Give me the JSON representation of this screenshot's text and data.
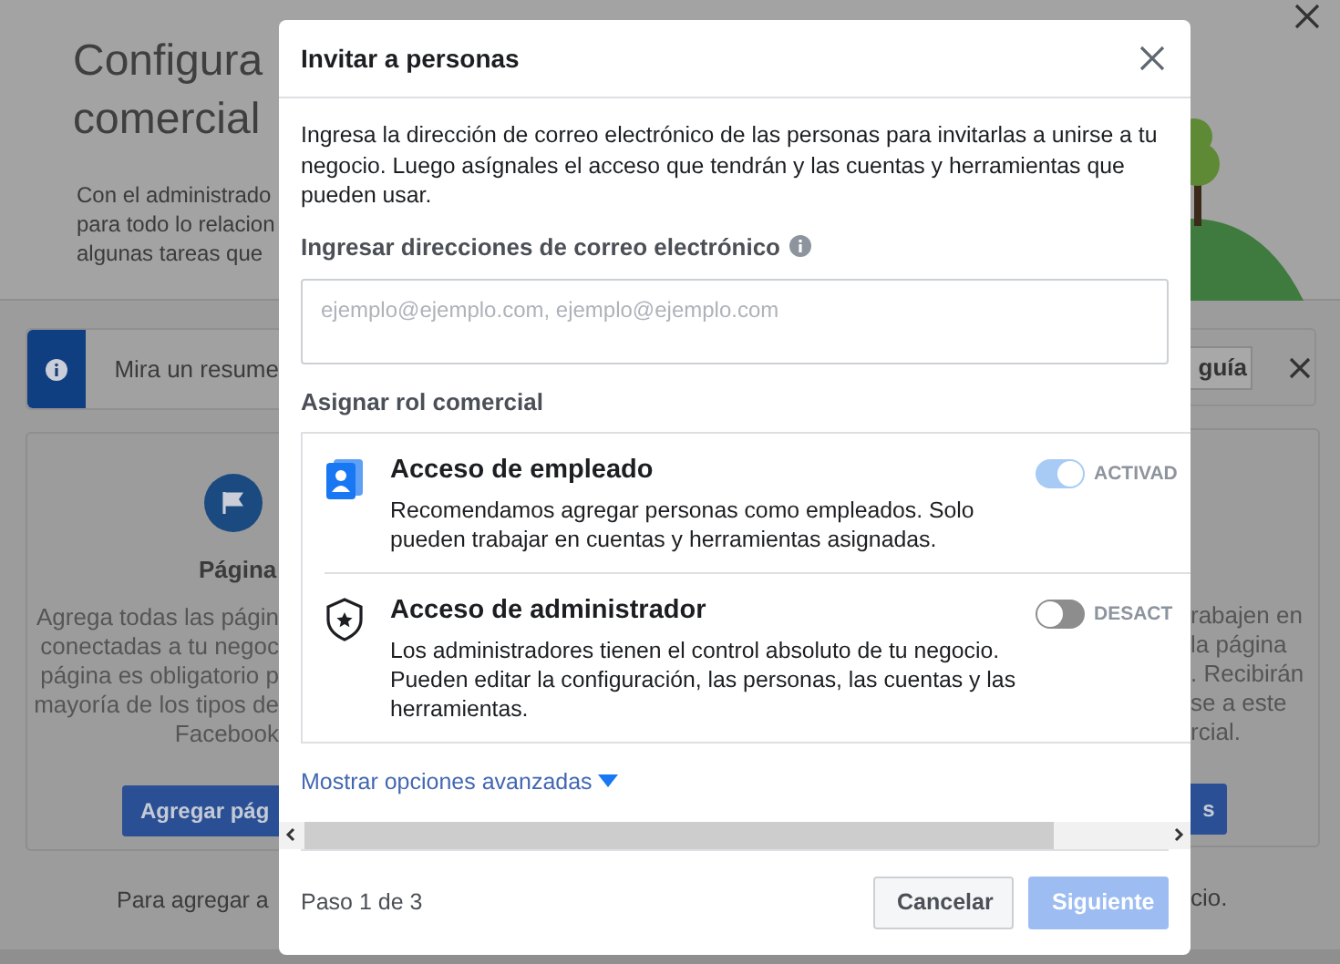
{
  "background": {
    "title_lines": [
      "Configura",
      "comercial"
    ],
    "intro_lines": [
      "Con el administrado",
      "para todo lo relacion",
      "algunas tareas que"
    ],
    "banner": {
      "text": "Mira un resume",
      "button": "guía"
    },
    "left_card": {
      "title": "Página",
      "lines": [
        "Agrega todas las págin",
        "conectadas a tu negoc",
        "página es obligatorio p",
        "mayoría de los tipos de",
        "Facebook"
      ],
      "button": "Agregar pág"
    },
    "right_card": {
      "lines": [
        "rabajen en",
        "la página",
        ". Recibirán",
        "se a este",
        "rcial."
      ],
      "button": "s"
    },
    "footer_left": "Para agregar a",
    "footer_right": "cio."
  },
  "modal": {
    "title": "Invitar a personas",
    "description": "Ingresa la dirección de correo electrónico de las personas para invitarlas a unirse a tu negocio. Luego asígnales el acceso que tendrán y las cuentas y herramientas que pueden usar.",
    "email_label": "Ingresar direcciones de correo electrónico",
    "email_placeholder": "ejemplo@ejemplo.com, ejemplo@ejemplo.com",
    "role_heading": "Asignar rol comercial",
    "roles": [
      {
        "kind": "employee",
        "name": "Acceso de empleado",
        "description": "Recomendamos agregar personas como empleados. Solo pueden trabajar en cuentas y herramientas asignadas.",
        "toggle_label": "ACTIVAD",
        "on": true
      },
      {
        "kind": "admin",
        "name": "Acceso de administrador",
        "description": "Los administradores tienen el control absoluto de tu negocio. Pueden editar la configuración, las personas, las cuentas y las herramientas.",
        "toggle_label": "DESACT",
        "on": false
      }
    ],
    "advanced_link": "Mostrar opciones avanzadas",
    "step": "Paso 1 de 3",
    "cancel": "Cancelar",
    "next": {
      "label": "Siguiente",
      "disabled": true
    }
  }
}
